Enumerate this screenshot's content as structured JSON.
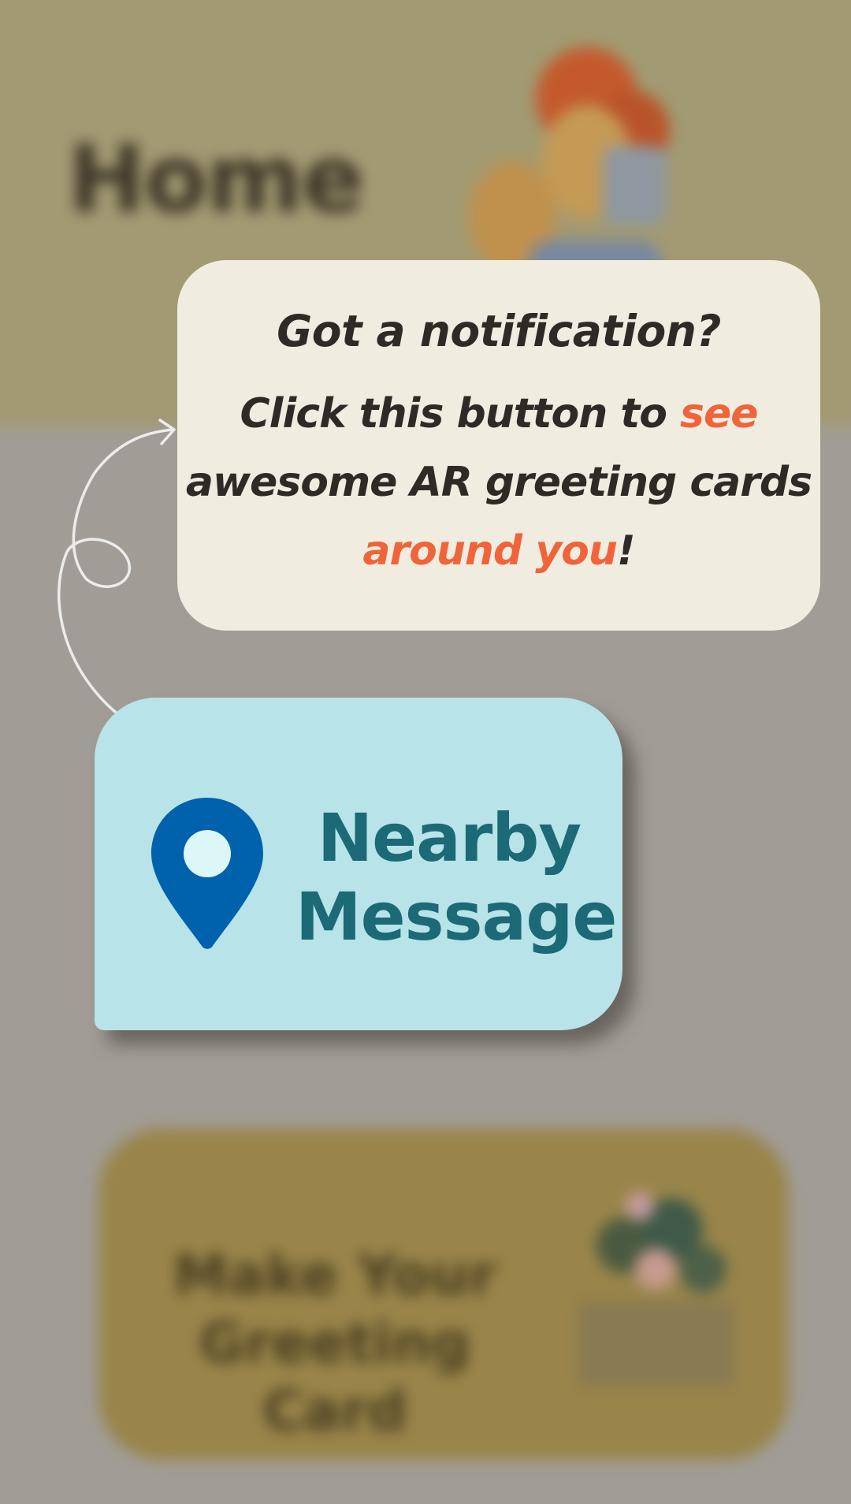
{
  "background": {
    "header_title": "Home",
    "card_label_line1": "Make Your",
    "card_label_line2": "Greeting Card"
  },
  "tooltip": {
    "title": "Got a notification?",
    "body_part1": "Click this button to ",
    "body_accent1": "see",
    "body_part2": " awesome AR greeting cards ",
    "body_accent2": "around you",
    "body_part3": "!"
  },
  "nearby_button": {
    "label_line1": "Nearby",
    "label_line2": "Message",
    "icon": "location-pin-icon"
  },
  "colors": {
    "tooltip_bg": "#f1ece0",
    "accent": "#f0643a",
    "button_bg": "#b8e3e8",
    "button_text": "#1b6a75",
    "pin": "#0062ad"
  }
}
